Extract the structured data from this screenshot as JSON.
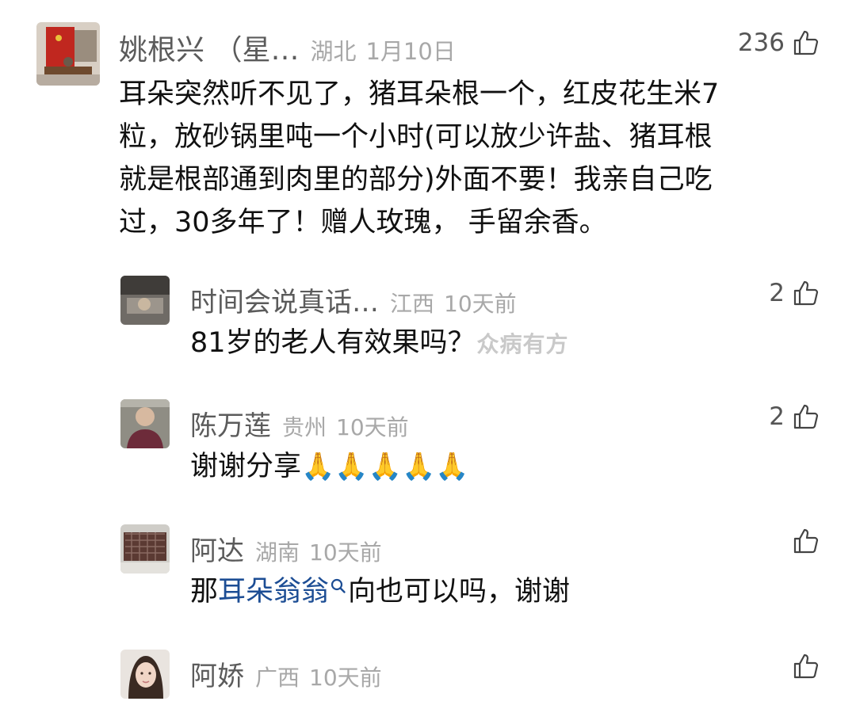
{
  "comments": [
    {
      "name": "姚根兴 （星…",
      "location": "湖北",
      "date": "1月10日",
      "likes": "236",
      "lines": [
        "耳朵突然听不见了，猪耳朵根一个，红皮花生米7",
        "粒，放砂锅里吨一个小时(可以放少许盐、猪耳根",
        "就是根部通到肉里的部分)外面不要！我亲自己吃",
        "过，30多年了！赠人玫瑰， 手留余香。"
      ]
    },
    {
      "name": "时间会说真话…",
      "location": "江西",
      "date": "10天前",
      "likes": "2",
      "text": "81岁的老人有效果吗？",
      "watermark": "众病有方"
    },
    {
      "name": "陈万莲",
      "location": "贵州",
      "date": "10天前",
      "likes": "2",
      "text": "谢谢分享",
      "emoji": "🙏🙏🙏🙏🙏"
    },
    {
      "name": "阿达",
      "location": "湖南",
      "date": "10天前",
      "likes": "",
      "text_before": "那",
      "link": "耳朵翁翁",
      "text_after": "向也可以吗，谢谢"
    },
    {
      "name": "阿娇",
      "location": "广西",
      "date": "10天前",
      "likes": ""
    }
  ],
  "icons": {
    "like": "thumbs-up-outline-icon",
    "search": "search-icon"
  },
  "colors": {
    "link": "#1c4d94",
    "meta": "#a8a8a8",
    "name": "#5b5b5b"
  }
}
